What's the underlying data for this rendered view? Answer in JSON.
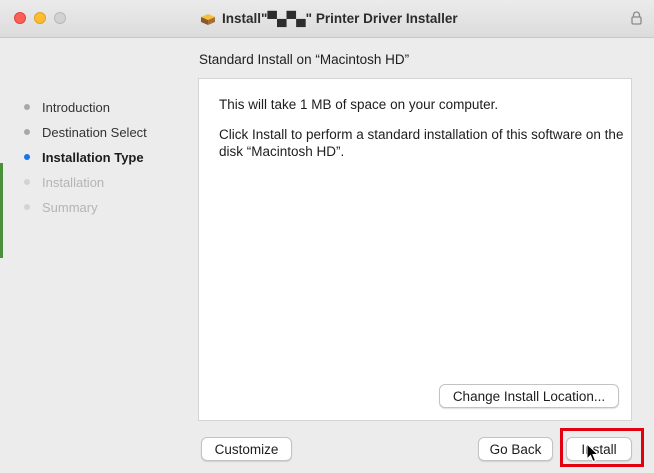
{
  "window": {
    "title": "Install\"▀▄▀▄\" Printer Driver Installer",
    "colors": {
      "close": "#fe5f57",
      "minimize": "#febc2e",
      "zoom": "#d2d2d2",
      "accent": "#1a73e8",
      "highlight": "#e3000f"
    }
  },
  "sidebar": {
    "items": [
      {
        "label": "Introduction",
        "state": "done"
      },
      {
        "label": "Destination Select",
        "state": "done"
      },
      {
        "label": "Installation Type",
        "state": "current"
      },
      {
        "label": "Installation",
        "state": "pending"
      },
      {
        "label": "Summary",
        "state": "pending"
      }
    ]
  },
  "main": {
    "heading": "Standard Install on “Macintosh HD”",
    "paragraph1": "This will take 1 MB of space on your computer.",
    "paragraph2": "Click Install to perform a standard installation of this software on the disk “Macintosh HD”.",
    "change_location_label": "Change Install Location..."
  },
  "footer": {
    "customize_label": "Customize",
    "go_back_label": "Go Back",
    "install_label": "Install"
  },
  "icons": [
    "package-icon",
    "lock-icon",
    "mouse-cursor-icon"
  ]
}
